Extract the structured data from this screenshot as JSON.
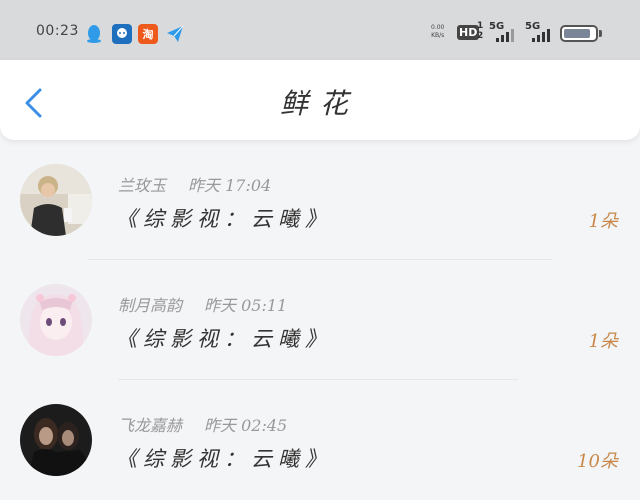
{
  "status_bar": {
    "time": "00:23",
    "net_speed_value": "0.00",
    "net_speed_unit": "KB/s",
    "hd_label": "HD",
    "hd_sub_top": "1",
    "hd_sub_bottom": "2",
    "signal1_label": "5G",
    "signal2_label": "5G",
    "icons": [
      "qq-icon",
      "message-icon",
      "taobao-icon",
      "send-icon"
    ],
    "tao_char": "淘"
  },
  "header": {
    "title": "鲜花"
  },
  "items": [
    {
      "name": "兰玫玉",
      "time": "昨天 17:04",
      "book": "《综影视：云曦》",
      "count": "1朵"
    },
    {
      "name": "制月高韵",
      "time": "昨天 05:11",
      "book": "《综影视：云曦》",
      "count": "1朵"
    },
    {
      "name": "飞龙嘉赫",
      "time": "昨天 02:45",
      "book": "《综影视：云曦》",
      "count": "10朵"
    }
  ],
  "colors": {
    "accent": "#3b8ee8",
    "count": "#c9884a",
    "status_bg": "#d9dadc"
  }
}
